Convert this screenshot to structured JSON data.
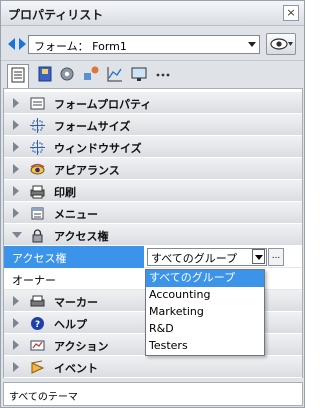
{
  "window": {
    "title": "プロパティリスト",
    "close_label": "×"
  },
  "selector": {
    "value": "フォーム： Form1"
  },
  "toolbar": {
    "tools": [
      "list-icon",
      "book-icon",
      "gear-icon",
      "shapes-icon",
      "chart-icon",
      "monitor-icon",
      "more-icon"
    ]
  },
  "categories": [
    {
      "label": "フォームプロパティ",
      "icon": "form-properties-icon",
      "open": false
    },
    {
      "label": "フォームサイズ",
      "icon": "form-size-icon",
      "open": false
    },
    {
      "label": "ウィンドウサイズ",
      "icon": "window-size-icon",
      "open": false
    },
    {
      "label": "アピアランス",
      "icon": "appearance-icon",
      "open": false
    },
    {
      "label": "印刷",
      "icon": "print-icon",
      "open": false
    },
    {
      "label": "メニュー",
      "icon": "menu-icon",
      "open": false
    },
    {
      "label": "アクセス権",
      "icon": "lock-icon",
      "open": true
    },
    {
      "label": "マーカー",
      "icon": "marker-icon",
      "open": false
    },
    {
      "label": "ヘルプ",
      "icon": "help-icon",
      "open": false
    },
    {
      "label": "アクション",
      "icon": "action-icon",
      "open": false
    },
    {
      "label": "イベント",
      "icon": "event-icon",
      "open": false
    }
  ],
  "properties": [
    {
      "name": "アクセス権",
      "value": "すべてのグループ",
      "selected": true
    },
    {
      "name": "オーナー",
      "value": "",
      "selected": false
    }
  ],
  "dropdown": {
    "options": [
      "すべてのグループ",
      "Accounting",
      "Marketing",
      "R&D",
      "Testers"
    ],
    "selected_index": 0
  },
  "ellipsis_label": "...",
  "status": {
    "text": "すべてのテーマ"
  },
  "colors": {
    "selection": "#3b93ea",
    "category_bg": "#dadde2",
    "panel_bg": "#dfe3e8"
  }
}
